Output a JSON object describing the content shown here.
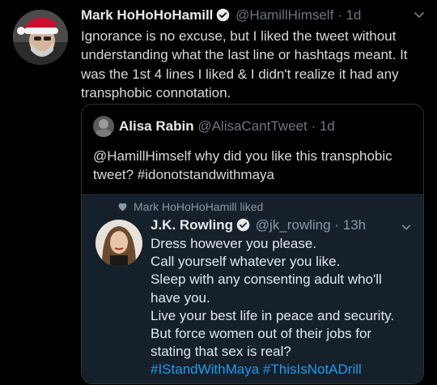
{
  "tweet": {
    "author_name": "Mark HoHoHoHamill",
    "handle": "@HamillHimself",
    "separator": "·",
    "time": "1d",
    "text": "Ignorance is no excuse, but I liked the tweet without understanding what the last line or hashtags meant. It was the 1st 4 lines I liked & I didn't realize it had any transphobic connotation."
  },
  "quote": {
    "author_name": "Alisa Rabin",
    "handle": "@AlisaCantTweet",
    "separator": "·",
    "time": "1d",
    "text": "@HamillHimself why did you like this transphobic tweet? #idonotstandwithmaya"
  },
  "liked_tweet": {
    "liked_by_text": "Mark HoHoHoHamill liked",
    "author_name": "J.K. Rowling",
    "handle": "@jk_rowling",
    "separator": "·",
    "time": "13h",
    "lines": [
      "Dress however you please.",
      "Call yourself whatever you like.",
      "Sleep with any consenting adult who'll",
      "have you.",
      "Live your best life in peace and security.",
      "But force women out of their jobs for",
      "stating that sex is real?"
    ],
    "hashtags": [
      "#IStandWithMaya",
      "#ThisIsNotADrill"
    ]
  },
  "colors": {
    "background": "#000000",
    "inner_card": "#15202b",
    "link": "#1d9bf0",
    "verified": "#e7e9ea"
  },
  "icons": [
    "santa-avatar",
    "verified-badge-icon",
    "chevron-down-icon",
    "heart-icon"
  ]
}
